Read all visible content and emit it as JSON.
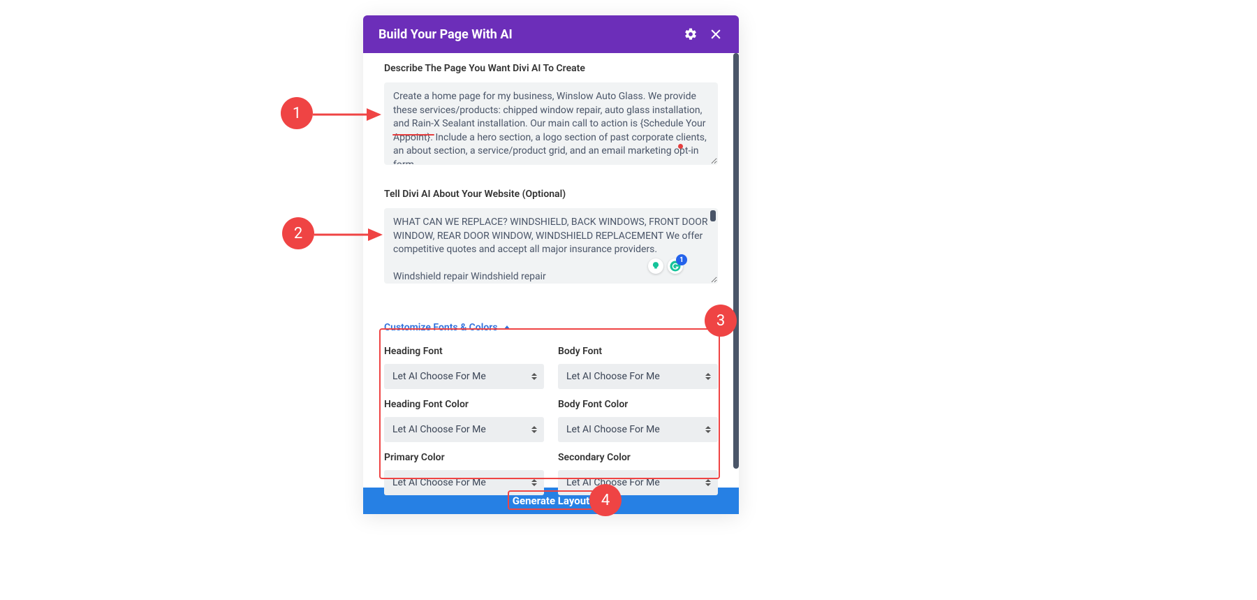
{
  "modal": {
    "title": "Build Your Page With AI"
  },
  "describe": {
    "label": "Describe The Page You Want Divi AI To Create",
    "value": "Create a home page for my business, Winslow Auto Glass. We provide these services/products: chipped window repair, auto glass installation, and Rain-X Sealant installation. Our main call to action is {Schedule Your Appoint}. Include a hero section, a logo section of past corporate clients, an about section, a service/product grid, and an email marketing opt-in form."
  },
  "about": {
    "label": "Tell Divi AI About Your Website (Optional)",
    "value": "WHAT CAN WE REPLACE? WINDSHIELD, BACK WINDOWS, FRONT DOOR WINDOW, REAR DOOR WINDOW, WINDSHIELD REPLACEMENT We offer competitive quotes and accept all major insurance providers.\n\nWindshield repair Windshield repair"
  },
  "customize": {
    "link": "Customize Fonts & Colors",
    "options": [
      {
        "label": "Heading Font",
        "value": "Let AI Choose For Me"
      },
      {
        "label": "Body Font",
        "value": "Let AI Choose For Me"
      },
      {
        "label": "Heading Font Color",
        "value": "Let AI Choose For Me"
      },
      {
        "label": "Body Font Color",
        "value": "Let AI Choose For Me"
      },
      {
        "label": "Primary Color",
        "value": "Let AI Choose For Me"
      },
      {
        "label": "Secondary Color",
        "value": "Let AI Choose For Me"
      }
    ]
  },
  "footer": {
    "button": "Generate Layout"
  },
  "annotations": {
    "n1": "1",
    "n2": "2",
    "n3": "3",
    "n4": "4",
    "grammar_count": "1"
  }
}
